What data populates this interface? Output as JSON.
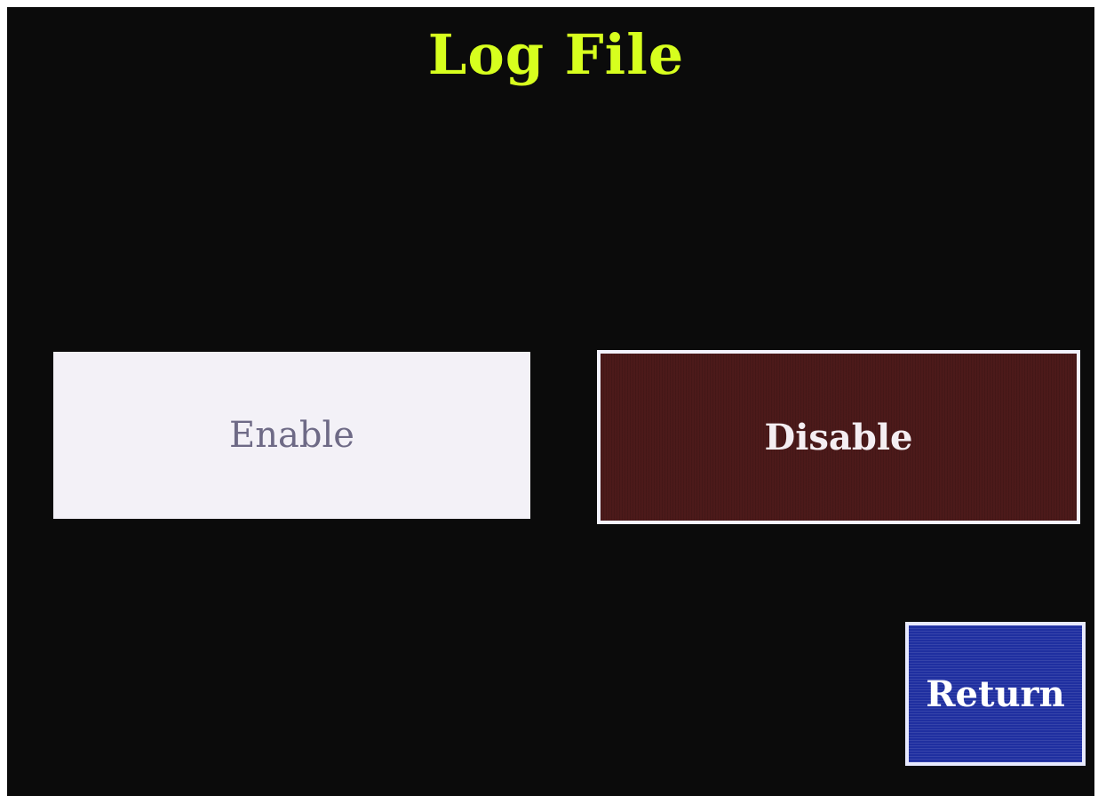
{
  "screen": {
    "title": "Log File",
    "title_color": "#d7ff1e",
    "background_color": "#0b0b0b"
  },
  "buttons": {
    "enable": {
      "label": "Enable",
      "bg_color": "#f3f1f7",
      "text_color": "#6e6a86"
    },
    "disable": {
      "label": "Disable",
      "bg_color": "#4c1a1a",
      "text_color": "#f4eef2",
      "selected": true
    },
    "return": {
      "label": "Return",
      "bg_color": "#1f2fa0",
      "text_color": "#ffffff"
    }
  }
}
